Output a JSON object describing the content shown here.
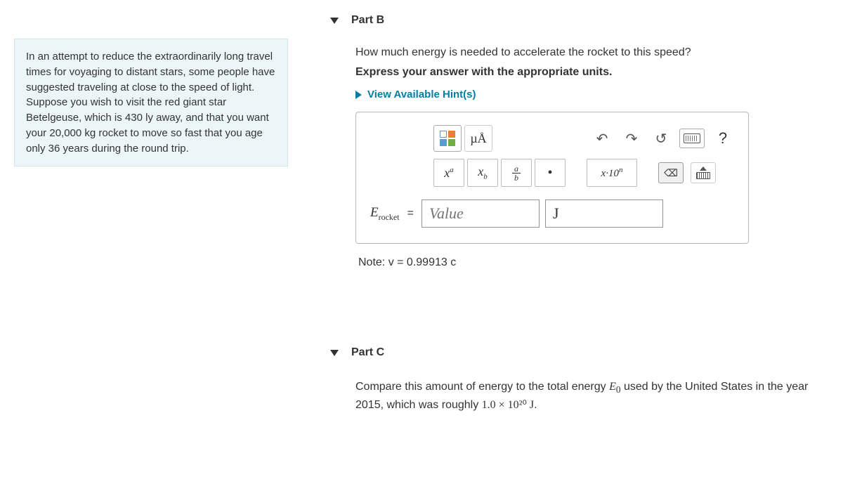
{
  "problem": {
    "text": "In an attempt to reduce the extraordinarily long travel times for voyaging to distant stars, some people have suggested traveling at close to the speed of light. Suppose you wish to visit the red giant star Betelgeuse, which is 430 ly away, and that you want your 20,000 kg rocket to move so fast that you age only 36 years during the round trip."
  },
  "partB": {
    "title": "Part B",
    "question": "How much energy is needed to accelerate the rocket to this speed?",
    "instruction": "Express your answer with the appropriate units.",
    "hints_label": "View Available Hint(s)",
    "toolbar": {
      "mu_a": "µÅ",
      "superscript": "xᵃ",
      "subscript_label_x": "x",
      "subscript_label_b": "b",
      "frac_top": "a",
      "frac_bot": "b",
      "dot": "•",
      "sci": "x·10ⁿ",
      "clear": "⌫"
    },
    "variable": "E",
    "variable_sub": "rocket",
    "equals": "=",
    "value_placeholder": "Value",
    "unit_value": "J",
    "note": "Note: v = 0.99913 c"
  },
  "partC": {
    "title": "Part C",
    "text_before": "Compare this amount of energy to the total energy ",
    "E0_var": "E",
    "E0_sub": "0",
    "text_mid": " used by the United States in the year 2015, which was roughly ",
    "value": "1.0 × 10²⁰ J",
    "text_after": "."
  },
  "icons": {
    "undo": "↶",
    "redo": "↷",
    "reset": "↺",
    "help": "?"
  }
}
